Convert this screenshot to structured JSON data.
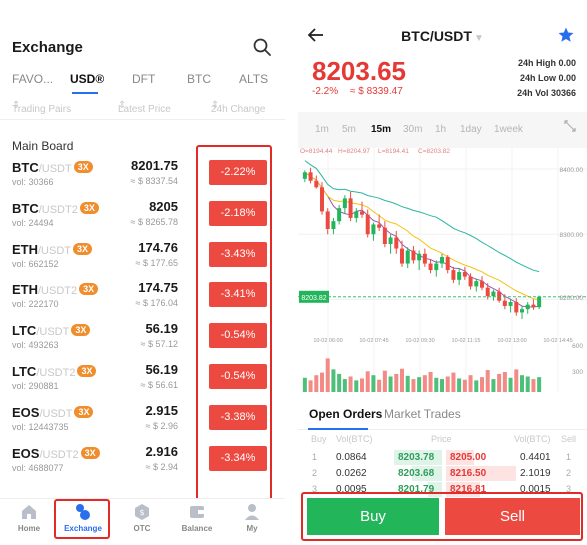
{
  "left": {
    "title": "Exchange",
    "tabs": [
      "FAVO...",
      "USD®",
      "DFT",
      "BTC",
      "ALTS"
    ],
    "columns": {
      "pairs": "Trading Pairs",
      "price": "Latest Price",
      "change": "24h Change"
    },
    "board": "Main Board",
    "rows": [
      {
        "base": "BTC",
        "quote": "/USDT",
        "lev": "3X",
        "vol": "vol: 30366",
        "price": "8201.75",
        "fiat": "≈ $ 8337.54",
        "change": "-2.22%"
      },
      {
        "base": "BTC",
        "quote": "/USDT2",
        "lev": "3X",
        "vol": "vol: 24494",
        "price": "8205",
        "fiat": "≈ $ 8265.78",
        "change": "-2.18%"
      },
      {
        "base": "ETH",
        "quote": "/USDT",
        "lev": "3X",
        "vol": "vol: 662152",
        "price": "174.76",
        "fiat": "≈ $ 177.65",
        "change": "-3.43%"
      },
      {
        "base": "ETH",
        "quote": "/USDT2",
        "lev": "3X",
        "vol": "vol: 222170",
        "price": "174.75",
        "fiat": "≈ $ 176.04",
        "change": "-3.41%"
      },
      {
        "base": "LTC",
        "quote": "/USDT",
        "lev": "3X",
        "vol": "vol: 493263",
        "price": "56.19",
        "fiat": "≈ $ 57.12",
        "change": "-0.54%"
      },
      {
        "base": "LTC",
        "quote": "/USDT2",
        "lev": "3X",
        "vol": "vol: 290881",
        "price": "56.19",
        "fiat": "≈ $ 56.61",
        "change": "-0.54%"
      },
      {
        "base": "EOS",
        "quote": "/USDT",
        "lev": "3X",
        "vol": "vol: 12443735",
        "price": "2.915",
        "fiat": "≈ $ 2.96",
        "change": "-3.38%"
      },
      {
        "base": "EOS",
        "quote": "/USDT2",
        "lev": "3X",
        "vol": "vol: 4688077",
        "price": "2.916",
        "fiat": "≈ $ 2.94",
        "change": "-3.34%"
      }
    ],
    "nav": [
      "Home",
      "Exchange",
      "OTC",
      "Balance",
      "My"
    ]
  },
  "right": {
    "pair": "BTC/USDT",
    "price": "8203.65",
    "change_pct": "-2.2%",
    "usd": "≈ $ 8339.47",
    "high": "24h High 0.00",
    "low": "24h Low 0.00",
    "vol": "24h Vol 30366",
    "timeframes": [
      "1m",
      "5m",
      "15m",
      "30m",
      "1h",
      "1day",
      "1week"
    ],
    "ohlc": {
      "o": "O=8194.44",
      "h": "H=8204.97",
      "l": "L=8194.41",
      "c": "C=8203.82"
    },
    "price_tag": "8203.82",
    "y_labels": [
      "8400.00",
      "8300.00",
      "8200.00"
    ],
    "x_labels": [
      "10-02 06:00",
      "10-02 07:45",
      "10-02 09:30",
      "10-02 11:15",
      "10-02 13:00",
      "10-02 14:45"
    ],
    "vol_labels": [
      "600",
      "300"
    ],
    "book_tabs": [
      "Open Orders",
      "Market Trades"
    ],
    "book_head": {
      "buy": "Buy",
      "vol_b": "Vol(BTC)",
      "price": "Price",
      "vol_s": "Vol(BTC)",
      "sell": "Sell"
    },
    "book": [
      {
        "n": "1",
        "bvol": "0.0864",
        "bid": "8203.78",
        "ask": "8205.00",
        "svol": "0.4401",
        "m": "1"
      },
      {
        "n": "2",
        "bvol": "0.0262",
        "bid": "8203.68",
        "ask": "8216.50",
        "svol": "2.1019",
        "m": "2"
      },
      {
        "n": "3",
        "bvol": "0.0095",
        "bid": "8201.79",
        "ask": "8216.81",
        "svol": "0.0015",
        "m": "3"
      }
    ],
    "buy": "Buy",
    "sell": "Sell"
  },
  "colors": {
    "accent": "#2a6ef0",
    "down": "#ec4a41",
    "up": "#22b55a",
    "badge": "#f08d2c",
    "highlight": "#e22a26"
  },
  "chart_data": {
    "type": "candlestick",
    "candles": [
      [
        8385,
        8398,
        8380,
        8395
      ],
      [
        8395,
        8402,
        8378,
        8382
      ],
      [
        8382,
        8390,
        8370,
        8372
      ],
      [
        8372,
        8380,
        8330,
        8335
      ],
      [
        8335,
        8340,
        8300,
        8308
      ],
      [
        8308,
        8325,
        8300,
        8320
      ],
      [
        8320,
        8345,
        8315,
        8340
      ],
      [
        8340,
        8360,
        8332,
        8355
      ],
      [
        8355,
        8365,
        8320,
        8325
      ],
      [
        8325,
        8340,
        8318,
        8335
      ],
      [
        8335,
        8350,
        8325,
        8330
      ],
      [
        8330,
        8338,
        8295,
        8300
      ],
      [
        8300,
        8318,
        8290,
        8315
      ],
      [
        8315,
        8330,
        8305,
        8310
      ],
      [
        8310,
        8320,
        8280,
        8285
      ],
      [
        8285,
        8300,
        8270,
        8295
      ],
      [
        8295,
        8305,
        8270,
        8278
      ],
      [
        8278,
        8290,
        8250,
        8255
      ],
      [
        8255,
        8280,
        8248,
        8275
      ],
      [
        8275,
        8282,
        8255,
        8260
      ],
      [
        8260,
        8275,
        8245,
        8270
      ],
      [
        8270,
        8278,
        8250,
        8255
      ],
      [
        8255,
        8262,
        8240,
        8245
      ],
      [
        8245,
        8260,
        8235,
        8255
      ],
      [
        8255,
        8270,
        8248,
        8265
      ],
      [
        8265,
        8268,
        8240,
        8245
      ],
      [
        8245,
        8250,
        8225,
        8230
      ],
      [
        8230,
        8248,
        8222,
        8242
      ],
      [
        8242,
        8250,
        8230,
        8235
      ],
      [
        8235,
        8240,
        8215,
        8220
      ],
      [
        8220,
        8232,
        8212,
        8228
      ],
      [
        8228,
        8236,
        8214,
        8218
      ],
      [
        8218,
        8225,
        8200,
        8205
      ],
      [
        8205,
        8215,
        8198,
        8212
      ],
      [
        8212,
        8218,
        8195,
        8198
      ],
      [
        8198,
        8208,
        8185,
        8190
      ],
      [
        8190,
        8200,
        8180,
        8196
      ],
      [
        8196,
        8202,
        8175,
        8180
      ],
      [
        8180,
        8190,
        8170,
        8185
      ],
      [
        8185,
        8196,
        8178,
        8192
      ],
      [
        8192,
        8200,
        8184,
        8188
      ],
      [
        8188,
        8206,
        8185,
        8204
      ]
    ],
    "volumes": [
      220,
      180,
      260,
      300,
      520,
      350,
      280,
      200,
      240,
      180,
      210,
      320,
      260,
      190,
      330,
      240,
      280,
      360,
      250,
      200,
      230,
      260,
      310,
      220,
      200,
      240,
      300,
      210,
      190,
      260,
      180,
      230,
      340,
      200,
      280,
      310,
      220,
      350,
      260,
      240,
      200,
      230
    ],
    "ylim": [
      8150,
      8420
    ],
    "vlim": [
      0,
      650
    ]
  }
}
